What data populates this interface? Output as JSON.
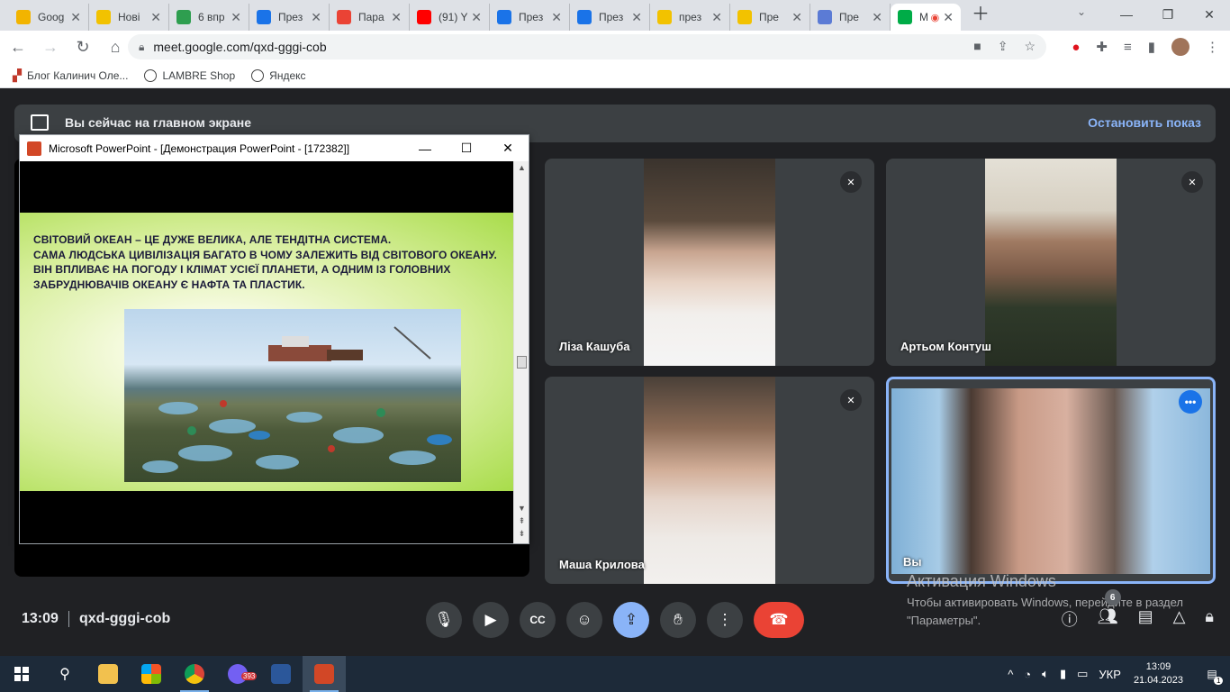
{
  "tabs": [
    {
      "label": "Goog",
      "color": "#f2b400"
    },
    {
      "label": "Нові",
      "color": "#f2c200"
    },
    {
      "label": "6 впр",
      "color": "#2e9e4f"
    },
    {
      "label": "През",
      "color": "#1a73e8"
    },
    {
      "label": "Пара",
      "color": "#ea4335"
    },
    {
      "label": "(91) Y",
      "color": "#ff0000"
    },
    {
      "label": "През",
      "color": "#1a73e8"
    },
    {
      "label": "През",
      "color": "#1a73e8"
    },
    {
      "label": "през",
      "color": "#f2c200"
    },
    {
      "label": "Пре",
      "color": "#f2c200"
    },
    {
      "label": "Пре",
      "color": "#5b7bd5"
    }
  ],
  "active_tab": {
    "label": "М",
    "color": "#00ac47"
  },
  "url": "meet.google.com/qxd-gggi-cob",
  "bookmarks": [
    "Блог Калинич Оле...",
    "LAMBRE Shop",
    "Яндекс"
  ],
  "banner": {
    "text": "Вы сейчас на главном экране",
    "stop": "Остановить показ"
  },
  "powerpoint": {
    "title": "Microsoft PowerPoint - [Демонстрация PowerPoint - [172382]]",
    "slide_text": "СВІТОВИЙ ОКЕАН – ЦЕ ДУЖЕ ВЕЛИКА, АЛЕ ТЕНДІТНА СИСТЕМА.\n САМА ЛЮДСЬКА ЦИВІЛІЗАЦІЯ БАГАТО В ЧОМУ ЗАЛЕЖИТЬ ВІД СВІТОВОГО ОКЕАНУ.\nВІН ВПЛИВАЄ НА ПОГОДУ І КЛІМАТ УСІЄЇ ПЛАНЕТИ, А ОДНИМ ІЗ ГОЛОВНИХ ЗАБРУДНЮВАЧІВ ОКЕАНУ Є НАФТА ТА ПЛАСТИК."
  },
  "participants": [
    {
      "name": "Ліза Кашуба",
      "muted": true
    },
    {
      "name": "Артьом Контуш",
      "muted": true
    },
    {
      "name": "Маша Крилова",
      "muted": true
    },
    {
      "name": "Вы",
      "muted": false
    }
  ],
  "bottom": {
    "time": "13:09",
    "code": "qxd-gggi-cob",
    "participants_count": "6"
  },
  "activation": {
    "title": "Активация Windows",
    "text": "Чтобы активировать Windows, перейдите в раздел \"Параметры\"."
  },
  "taskbar": {
    "lang": "УКР",
    "time": "13:09",
    "date": "21.04.2023",
    "viber_count": "393",
    "notif_count": "1"
  }
}
